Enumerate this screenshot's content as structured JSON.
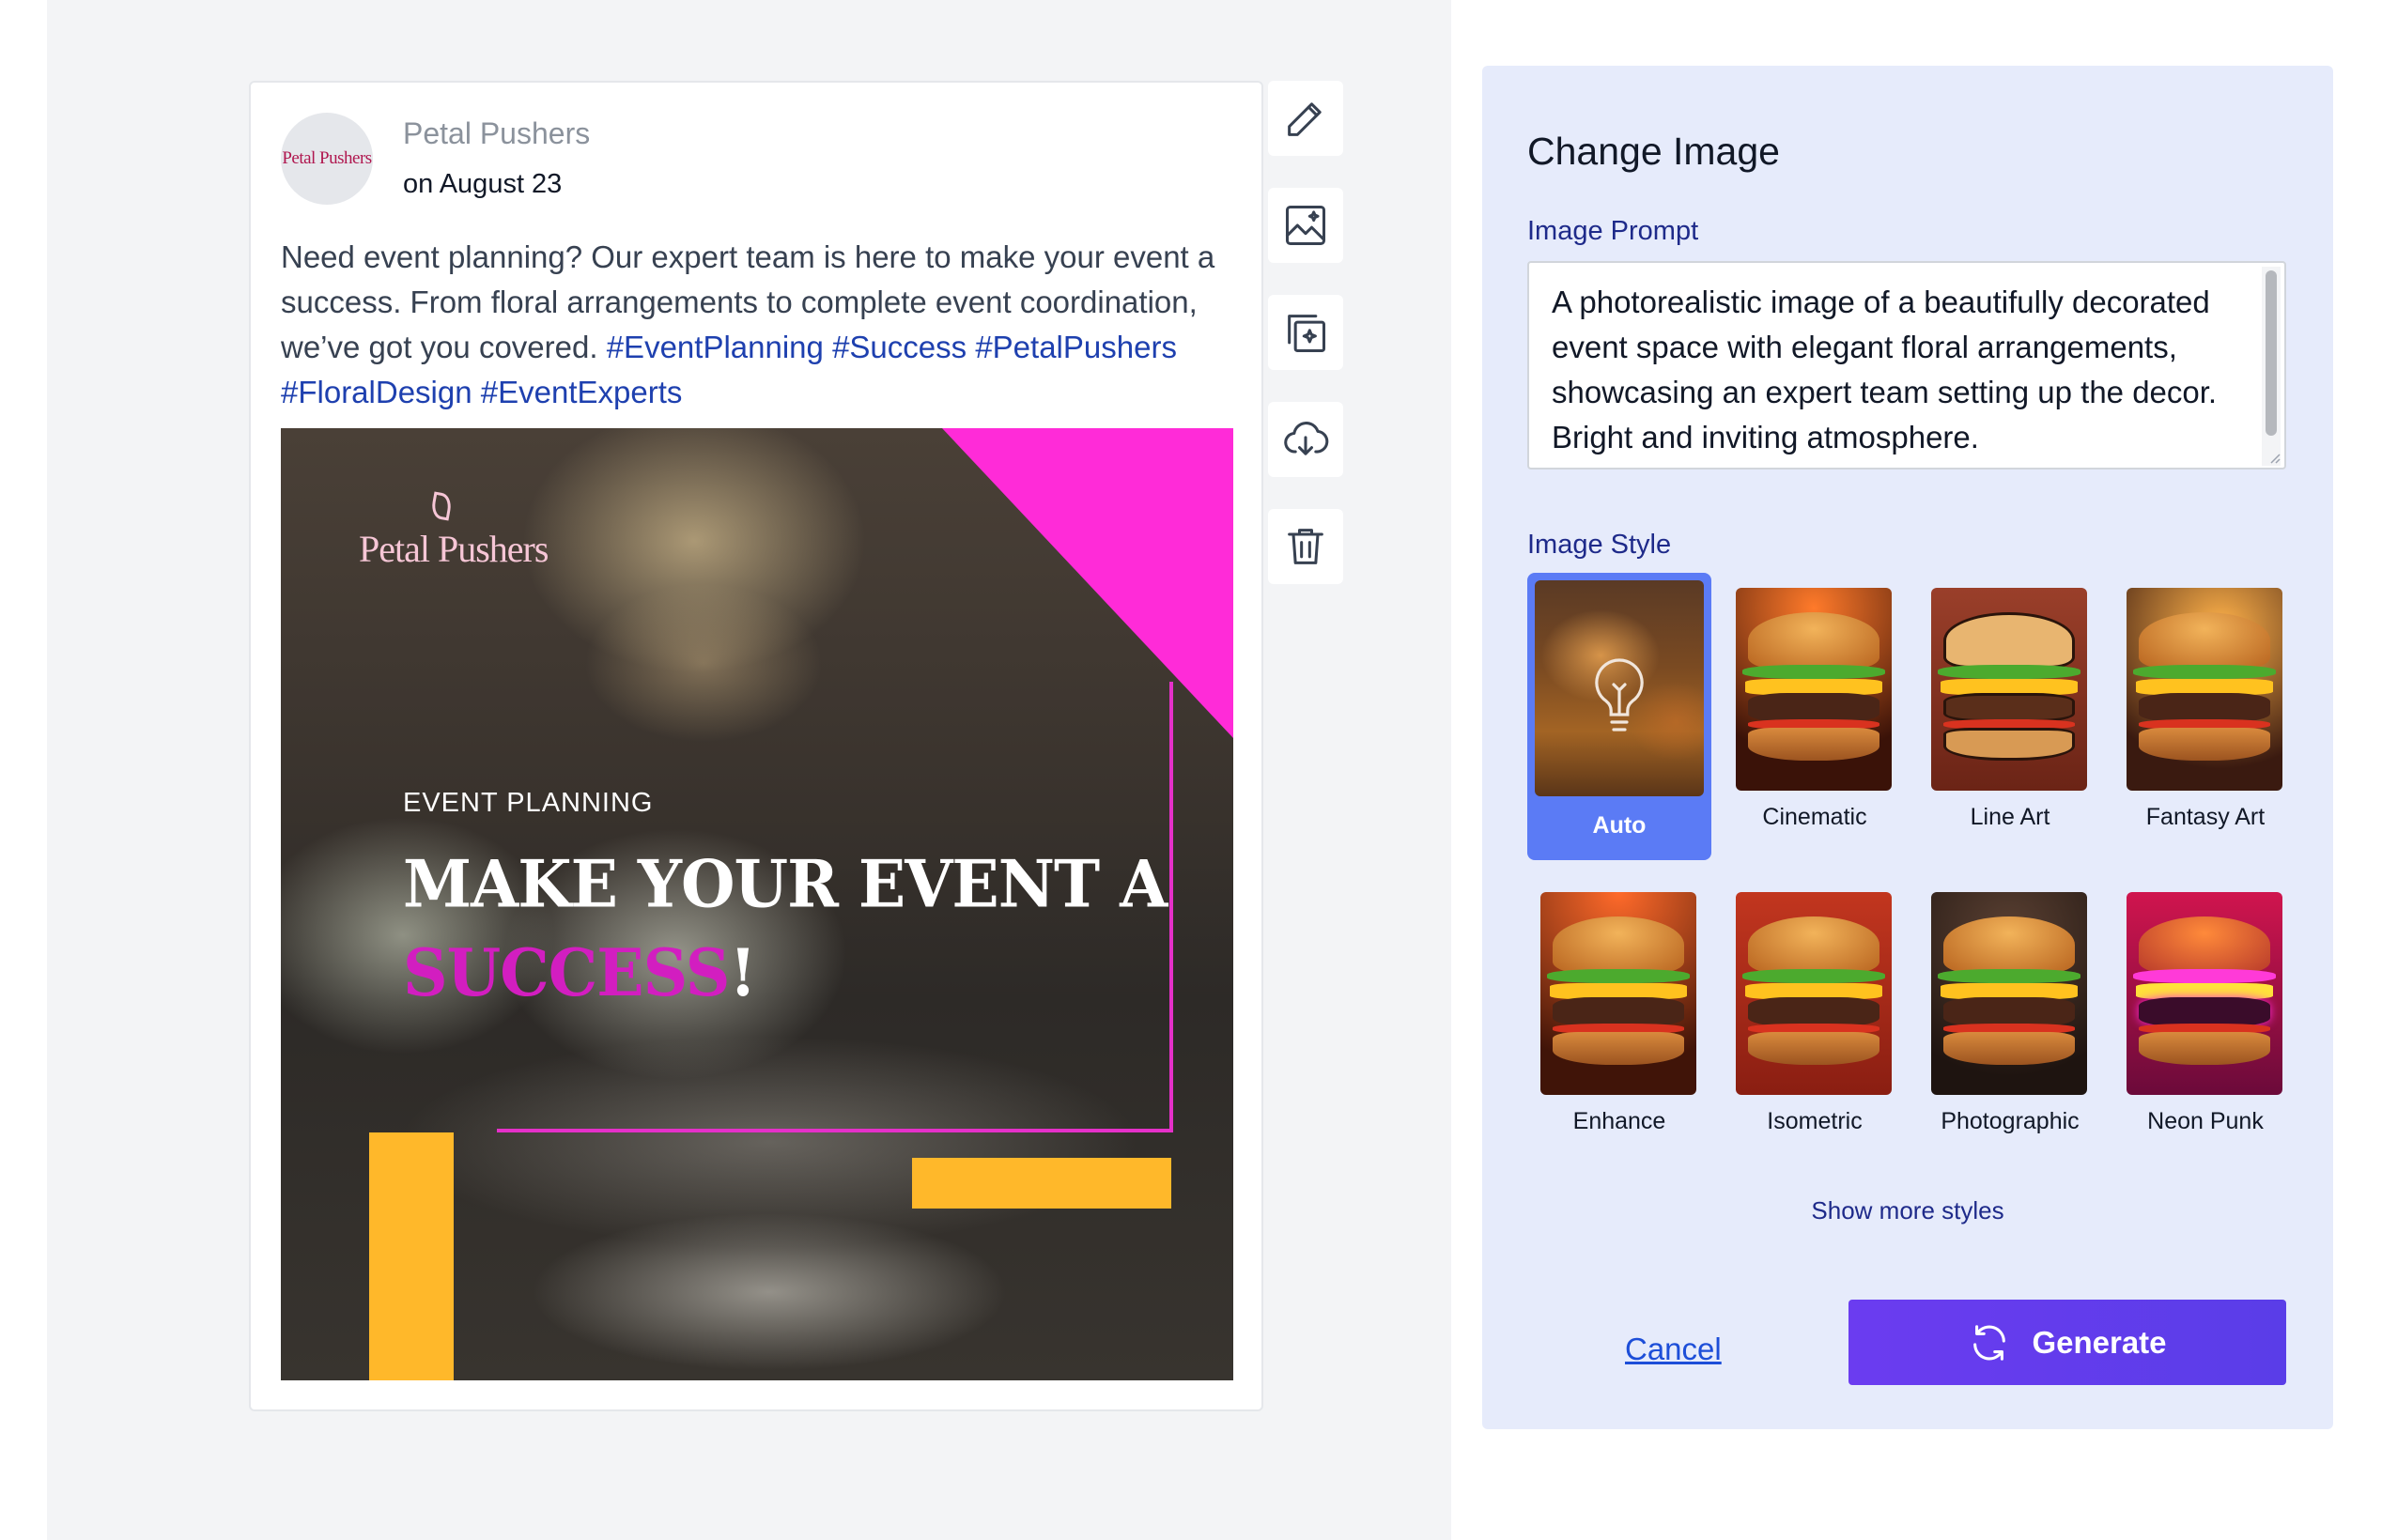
{
  "post": {
    "author": "Petal Pushers",
    "avatar_text": "Petal Pushers",
    "date": "on August 23",
    "body": "Need event planning? Our expert team is here to make your event a success. From floral arrangements to complete event coordination, we’ve got you covered.",
    "hashtags": [
      "#EventPlanning",
      "#Success",
      "#PetalPushers",
      "#FloralDesign",
      "#EventExperts"
    ],
    "image": {
      "logo": "Petal Pushers",
      "subtitle": "EVENT PLANNING",
      "headline_line1": "MAKE YOUR EVENT A",
      "headline_accent": "SUCCESS",
      "headline_end": "!"
    }
  },
  "toolbar": [
    "pencil-icon",
    "image-icon",
    "copy-sparkle-icon",
    "cloud-download-icon",
    "trash-icon"
  ],
  "panel": {
    "title": "Change Image",
    "prompt_label": "Image Prompt",
    "prompt_value": "A photorealistic image of a beautifully decorated event space with elegant floral arrangements, showcasing an expert team setting up the decor. Bright and inviting atmosphere.",
    "style_label": "Image Style",
    "styles": [
      {
        "label": "Auto",
        "selected": true
      },
      {
        "label": "Cinematic",
        "selected": false
      },
      {
        "label": "Line Art",
        "selected": false
      },
      {
        "label": "Fantasy Art",
        "selected": false
      },
      {
        "label": "Enhance",
        "selected": false
      },
      {
        "label": "Isometric",
        "selected": false
      },
      {
        "label": "Photographic",
        "selected": false
      },
      {
        "label": "Neon Punk",
        "selected": false
      }
    ],
    "show_more": "Show more styles",
    "cancel": "Cancel",
    "generate": "Generate"
  },
  "colors": {
    "accent": "#5b3df0",
    "selected_tile": "#5b7bf5",
    "hashtag": "#1e40af",
    "image_magenta": "#ff2bd8",
    "image_yellow": "#ffb82a"
  }
}
